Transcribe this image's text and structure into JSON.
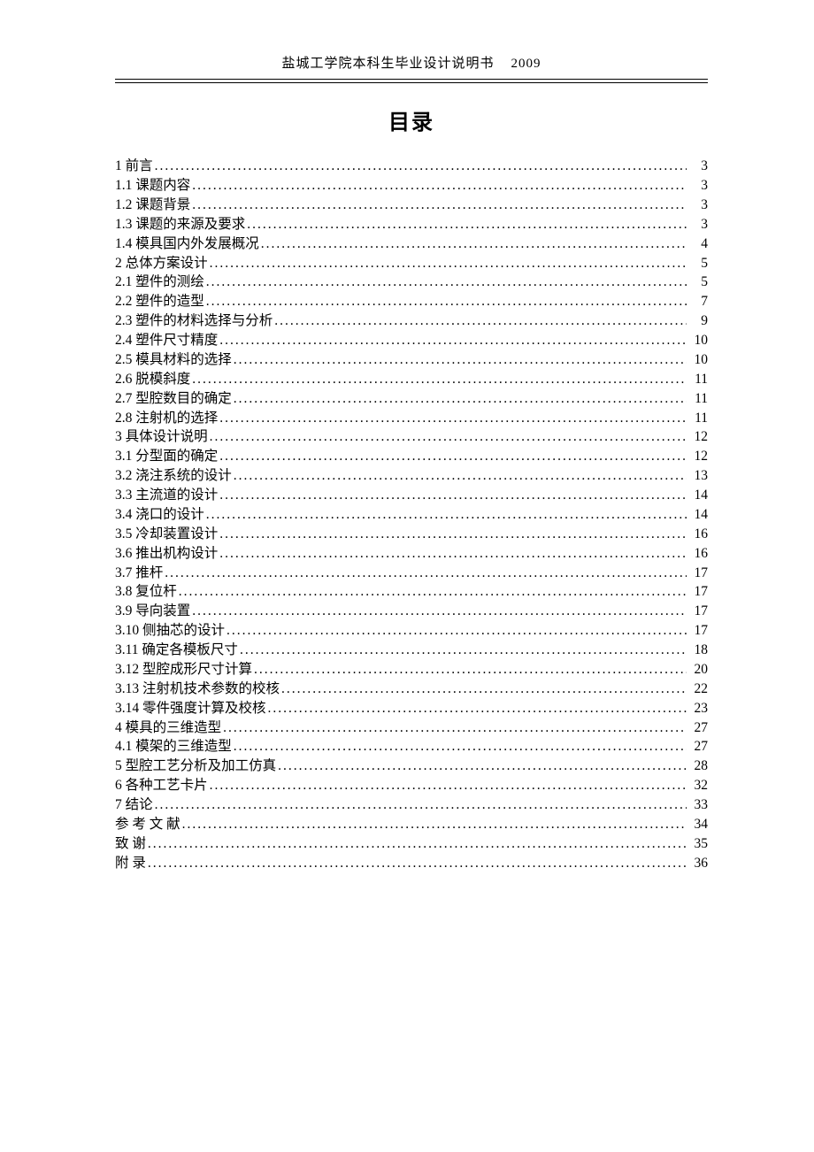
{
  "header": {
    "institution": "盐城工学院本科生毕业设计说明书",
    "year": "2009"
  },
  "title": "目录",
  "toc": [
    {
      "label": "1 前言",
      "page": "3"
    },
    {
      "label": "1.1 课题内容",
      "page": "3"
    },
    {
      "label": "1.2 课题背景",
      "page": "3"
    },
    {
      "label": "1.3 课题的来源及要求",
      "page": "3"
    },
    {
      "label": "1.4 模具国内外发展概况",
      "page": "4"
    },
    {
      "label": "2 总体方案设计",
      "page": "5"
    },
    {
      "label": "2.1 塑件的测绘",
      "page": "5"
    },
    {
      "label": "2.2 塑件的造型",
      "page": "7"
    },
    {
      "label": "2.3 塑件的材料选择与分析",
      "page": "9"
    },
    {
      "label": "2.4 塑件尺寸精度",
      "page": "10"
    },
    {
      "label": "2.5 模具材料的选择",
      "page": "10"
    },
    {
      "label": "2.6 脱模斜度",
      "page": "11"
    },
    {
      "label": "2.7 型腔数目的确定",
      "page": "11"
    },
    {
      "label": "2.8 注射机的选择",
      "page": "11"
    },
    {
      "label": "3 具体设计说明",
      "page": "12"
    },
    {
      "label": "3.1 分型面的确定",
      "page": "12"
    },
    {
      "label": "3.2 浇注系统的设计",
      "page": "13"
    },
    {
      "label": "3.3 主流道的设计",
      "page": "14"
    },
    {
      "label": "3.4 浇口的设计",
      "page": "14"
    },
    {
      "label": "3.5 冷却装置设计",
      "page": "16"
    },
    {
      "label": "3.6 推出机构设计",
      "page": "16"
    },
    {
      "label": "3.7  推杆",
      "page": "17"
    },
    {
      "label": "3.8  复位杆",
      "page": "17"
    },
    {
      "label": "3.9  导向装置",
      "page": "17"
    },
    {
      "label": "3.10  侧抽芯的设计",
      "page": "17"
    },
    {
      "label": "3.11 确定各模板尺寸",
      "page": "18"
    },
    {
      "label": "3.12 型腔成形尺寸计算",
      "page": "20"
    },
    {
      "label": "3.13 注射机技术参数的校核",
      "page": "22"
    },
    {
      "label": "3.14 零件强度计算及校核",
      "page": "23"
    },
    {
      "label": "4 模具的三维造型",
      "page": "27"
    },
    {
      "label": "4.1 模架的三维造型",
      "page": "27"
    },
    {
      "label": "5 型腔工艺分析及加工仿真",
      "page": "28"
    },
    {
      "label": "6 各种工艺卡片",
      "page": "32"
    },
    {
      "label": "7 结论",
      "page": "33"
    },
    {
      "label": "参 考 文 献",
      "page": "34"
    },
    {
      "label": "致      谢",
      "page": "35"
    },
    {
      "label": "附      录",
      "page": "36"
    }
  ]
}
